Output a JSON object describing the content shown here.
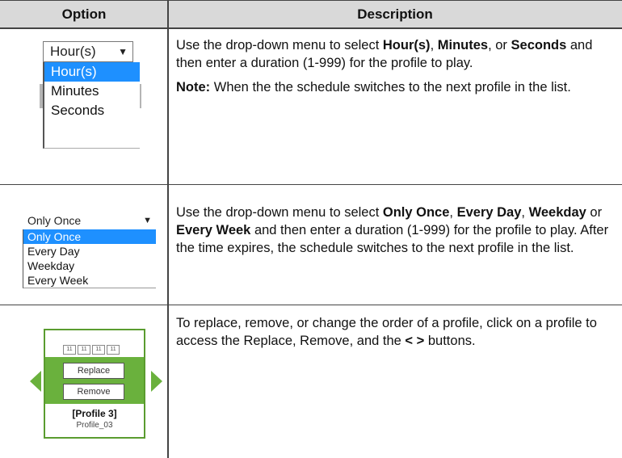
{
  "header": {
    "option": "Option",
    "description": "Description"
  },
  "row1": {
    "selected": "Hour(s)",
    "options": [
      "Hour(s)",
      "Minutes",
      "Seconds"
    ],
    "desc": {
      "t1": "Use the drop-down menu to select ",
      "b1": "Hour(s)",
      "t2": ", ",
      "b2": "Minutes",
      "t3": ", or ",
      "b3": "Seconds",
      "t4": " and then enter a duration (1-999) for the profile to play.",
      "note_label": "Note:",
      "note_text": " When the the schedule switches to the next profile in the list."
    }
  },
  "row2": {
    "selected": "Only Once",
    "options": [
      "Only Once",
      "Every Day",
      "Weekday",
      "Every Week"
    ],
    "desc": {
      "t1": "Use the drop-down menu to select ",
      "b1": "Only Once",
      "t2": ", ",
      "b2": "Every Day",
      "t3": ", ",
      "b3": "Weekday",
      "t4": " or ",
      "b4": "Every Week",
      "t5": " and then enter a duration (1-999) for the profile to play. After the time expires, the schedule switches to the next profile in the list."
    }
  },
  "row3": {
    "mini_labels": [
      "11",
      "11",
      "11",
      "11"
    ],
    "replace": "Replace",
    "remove": "Remove",
    "profile": "[Profile 3]",
    "profile_sub": "Profile_03",
    "desc": {
      "t1": "To replace, remove, or change the order of a profile, click on a profile to access the Replace, Remove, and the ",
      "b1": "< >",
      "t2": " buttons."
    }
  },
  "colors": {
    "accent_blue": "#1e90ff",
    "green": "#6ab13d",
    "header_bg": "#d9d9d9"
  }
}
